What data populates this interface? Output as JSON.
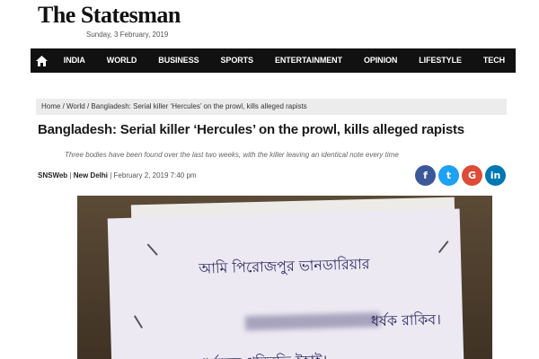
{
  "site": {
    "logo": "The Statesman",
    "date": "Sunday, 3 February, 2019"
  },
  "nav": {
    "home_icon": "home-icon",
    "items": [
      "INDIA",
      "WORLD",
      "BUSINESS",
      "SPORTS",
      "ENTERTAINMENT",
      "OPINION",
      "LIFESTYLE",
      "TECH"
    ]
  },
  "article": {
    "breadcrumb": "Home / World / Bangladesh: Serial killer ‘Hercules’ on the prowl, kills alleged rapists",
    "headline": "Bangladesh: Serial killer ‘Hercules’ on the prowl, kills alleged rapists",
    "summary": "Three bodies have been found over the last two weeks, with the killer leaving an identical note every time",
    "source": "SNSWeb",
    "location": "New Delhi",
    "published": "February 2, 2019 7:40 pm"
  },
  "share": [
    {
      "icon": "facebook-icon",
      "label": "f",
      "color": "#3b5998"
    },
    {
      "icon": "twitter-icon",
      "label": "t",
      "color": "#1da1f2"
    },
    {
      "icon": "google-plus-icon",
      "label": "G",
      "color": "#dd4b39"
    },
    {
      "icon": "linkedin-icon",
      "label": "in",
      "color": "#0077b5"
    }
  ],
  "photo_note": {
    "line1": "আমি পিরোজপুর ভানডারিয়ার",
    "line2": "ধর্ষক রাকিব।",
    "line3": "ধর্ষকের পরিনতি ইহাই।"
  }
}
